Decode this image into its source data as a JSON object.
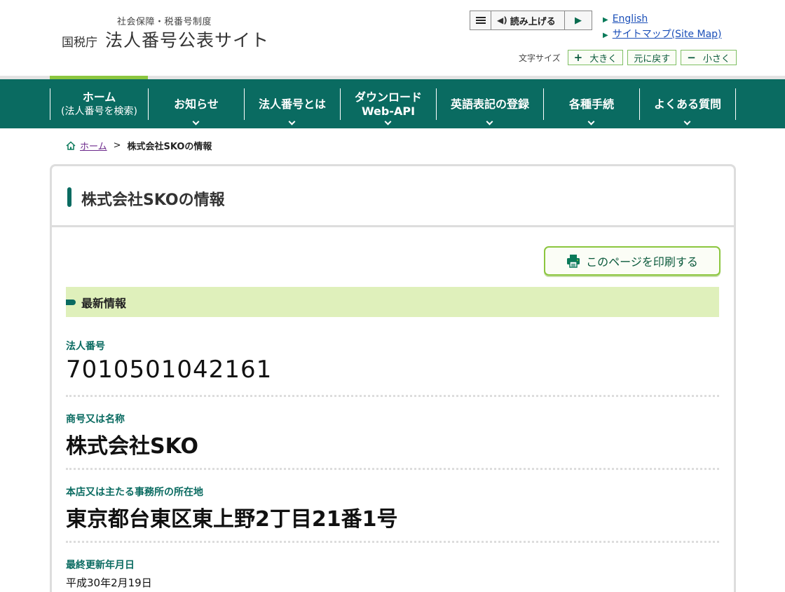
{
  "header": {
    "logo_sub": "社会保障・税番号制度",
    "logo_agency": "国税庁",
    "logo_main": "法人番号公表サイト",
    "tts_read_label": "読み上げる",
    "links": [
      "English",
      "サイトマップ(Site Map)"
    ],
    "fontsize_label": "文字サイズ",
    "fontsize_buttons": {
      "bigger": "大きく",
      "reset": "元に戻す",
      "smaller": "小さく"
    }
  },
  "nav": [
    {
      "line1": "ホーム",
      "line2": "(法人番号を検索)"
    },
    {
      "line1": "お知らせ",
      "line2": ""
    },
    {
      "line1": "法人番号とは",
      "line2": ""
    },
    {
      "line1": "ダウンロード",
      "line2": "Web-API"
    },
    {
      "line1": "英語表記の登録",
      "line2": ""
    },
    {
      "line1": "各種手続",
      "line2": ""
    },
    {
      "line1": "よくある質問",
      "line2": ""
    }
  ],
  "breadcrumb": {
    "home": "ホーム",
    "separator": ">",
    "current": "株式会社SKOの情報"
  },
  "page": {
    "title": "株式会社SKOの情報",
    "print_label": "このページを印刷する",
    "section_title": "最新情報"
  },
  "fields": {
    "corp_number": {
      "label": "法人番号",
      "value": "7010501042161"
    },
    "name": {
      "label": "商号又は名称",
      "value": "株式会社SKO"
    },
    "address": {
      "label": "本店又は主たる事務所の所在地",
      "value": "東京都台東区東上野2丁目21番1号"
    },
    "updated": {
      "label": "最終更新年月日",
      "value": "平成30年2月19日"
    }
  },
  "colors": {
    "brand": "#0a6b61",
    "accent": "#8cc63f",
    "section_bg": "#dff0bb",
    "link": "#1b4fb8"
  }
}
